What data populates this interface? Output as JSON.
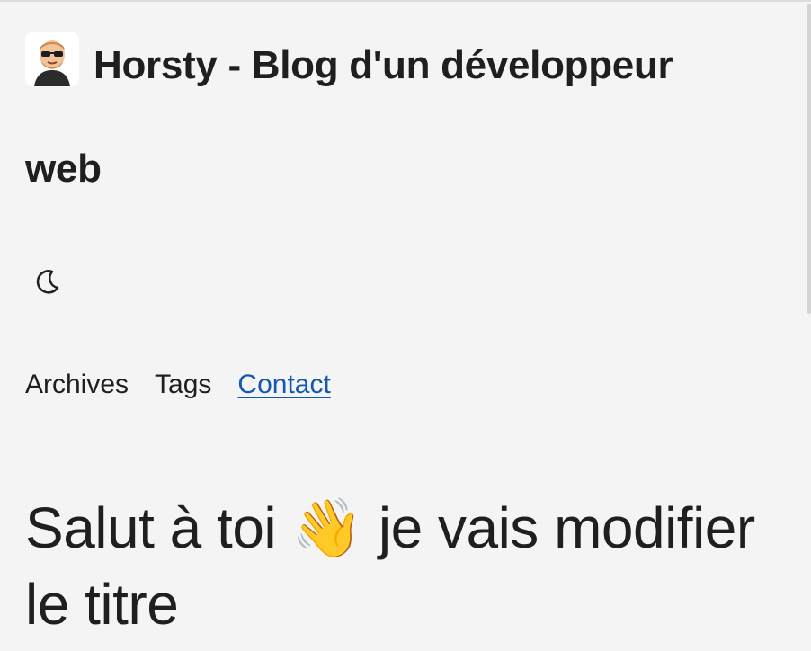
{
  "site": {
    "title_part1": "Horsty - Blog d'un développeur",
    "title_part2": "web",
    "avatar_icon": "memoji-avatar"
  },
  "theme_toggle": {
    "icon": "moon-icon"
  },
  "nav": {
    "items": [
      {
        "label": "Archives",
        "active": false
      },
      {
        "label": "Tags",
        "active": false
      },
      {
        "label": "Contact",
        "active": true
      }
    ]
  },
  "post": {
    "title_before_emoji": "Salut à toi",
    "emoji": "👋",
    "title_after_emoji": "je vais modifier le titre"
  },
  "colors": {
    "background": "#f4f4f5",
    "text": "#1f1f1f",
    "link_active": "#1458b0"
  }
}
